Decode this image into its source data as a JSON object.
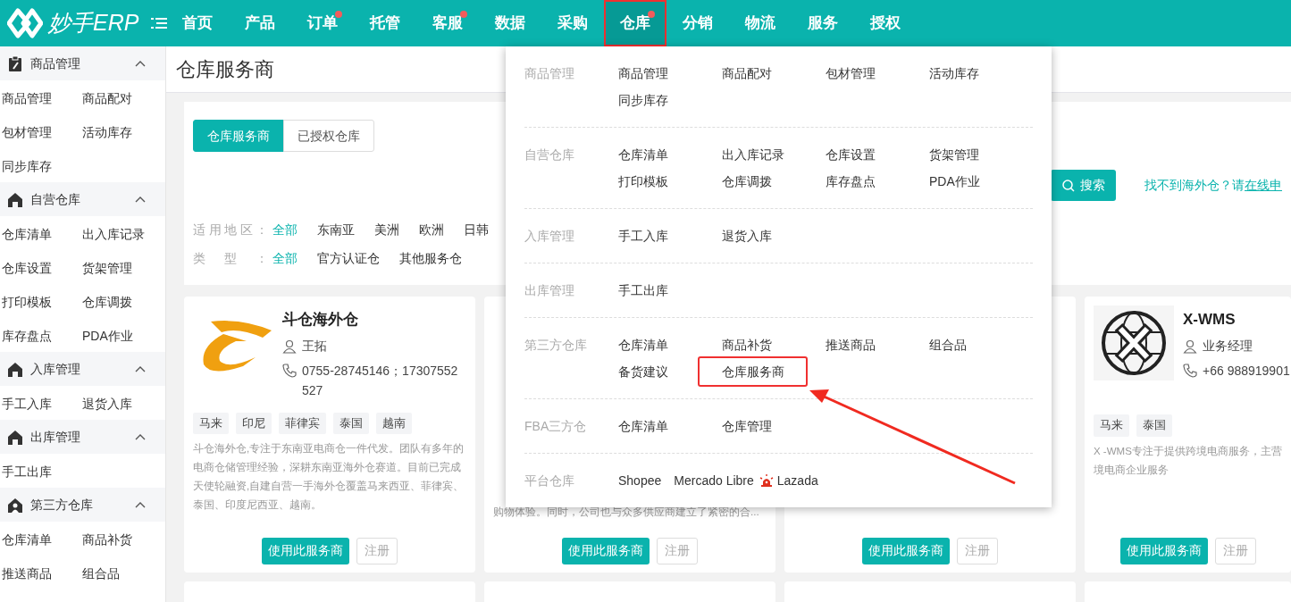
{
  "brand": {
    "name": "妙手ERP"
  },
  "nav": [
    {
      "label": "首页",
      "dot": false,
      "selected": false,
      "highlighted": false
    },
    {
      "label": "产品",
      "dot": false,
      "selected": false,
      "highlighted": false
    },
    {
      "label": "订单",
      "dot": true,
      "selected": false,
      "highlighted": false
    },
    {
      "label": "托管",
      "dot": false,
      "selected": false,
      "highlighted": false
    },
    {
      "label": "客服",
      "dot": true,
      "selected": false,
      "highlighted": false
    },
    {
      "label": "数据",
      "dot": false,
      "selected": false,
      "highlighted": false
    },
    {
      "label": "采购",
      "dot": false,
      "selected": false,
      "highlighted": false
    },
    {
      "label": "仓库",
      "dot": true,
      "selected": true,
      "highlighted": true
    },
    {
      "label": "分销",
      "dot": false,
      "selected": false,
      "highlighted": false
    },
    {
      "label": "物流",
      "dot": false,
      "selected": false,
      "highlighted": false
    },
    {
      "label": "服务",
      "dot": false,
      "selected": false,
      "highlighted": false
    },
    {
      "label": "授权",
      "dot": false,
      "selected": false,
      "highlighted": false
    }
  ],
  "sidebar": [
    {
      "title": "商品管理",
      "expanded": true,
      "items": [
        "商品管理",
        "商品配对",
        "包材管理",
        "活动库存",
        "同步库存"
      ]
    },
    {
      "title": "自营仓库",
      "expanded": true,
      "items": [
        "仓库清单",
        "出入库记录",
        "仓库设置",
        "货架管理",
        "打印模板",
        "仓库调拨",
        "库存盘点",
        "PDA作业"
      ]
    },
    {
      "title": "入库管理",
      "expanded": true,
      "items": [
        "手工入库",
        "退货入库"
      ]
    },
    {
      "title": "出库管理",
      "expanded": true,
      "items": [
        "手工出库"
      ]
    },
    {
      "title": "第三方仓库",
      "expanded": true,
      "items": [
        "仓库清单",
        "商品补货",
        "推送商品",
        "组合品"
      ]
    }
  ],
  "page_title": "仓库服务商",
  "tabs": [
    {
      "label": "仓库服务商",
      "selected": true
    },
    {
      "label": "已授权仓库",
      "selected": false
    }
  ],
  "search": {
    "label": "搜索"
  },
  "help": {
    "text": "找不到海外仓？请",
    "link": "在线申"
  },
  "filters": [
    {
      "label": "适用地区：",
      "options": [
        {
          "label": "全部",
          "selected": true
        },
        {
          "label": "东南亚",
          "selected": false
        },
        {
          "label": "美洲",
          "selected": false
        },
        {
          "label": "欧洲",
          "selected": false
        },
        {
          "label": "日韩",
          "selected": false
        }
      ]
    },
    {
      "label": "类型：",
      "options": [
        {
          "label": "全部",
          "selected": true
        },
        {
          "label": "官方认证仓",
          "selected": false
        },
        {
          "label": "其他服务仓",
          "selected": false
        }
      ]
    }
  ],
  "cards": [
    {
      "title": "斗仓海外仓",
      "contact": "王拓",
      "phone": "0755-28745146；17307552527",
      "tags": [
        "马来",
        "印尼",
        "菲律宾",
        "泰国",
        "越南"
      ],
      "description": [
        "斗仓海外仓,专注于东南亚电商仓一件代发。团队有多年的",
        "电商仓储管理经验，深耕东南亚海外仓赛道。目前已完成",
        "天使轮融资,自建自营一手海外仓覆盖马来西亚、菲律宾、",
        "泰国、印度尼西亚、越南。"
      ],
      "primary": "使用此服务商",
      "secondary": "注册"
    },
    {
      "description": [
        "购物体验。同时，公司也与众多供应商建立了紧密的合..."
      ],
      "primary": "使用此服务商",
      "secondary": "注册"
    },
    {
      "primary": "使用此服务商",
      "secondary": "注册"
    },
    {
      "title": "X-WMS",
      "contact": "业务经理",
      "phone": "+66 988919901",
      "tags": [
        "马来",
        "泰国"
      ],
      "description": [
        "X -WMS专注于提供跨境电商服务，主营",
        "境电商企业服务"
      ],
      "primary": "使用此服务商",
      "secondary": "注册"
    }
  ],
  "dropdown": {
    "sections": [
      {
        "label": "商品管理",
        "items": [
          {
            "label": "商品管理"
          },
          {
            "label": "商品配对"
          },
          {
            "label": "包材管理"
          },
          {
            "label": "活动库存"
          },
          {
            "label": "同步库存"
          }
        ]
      },
      {
        "label": "自营仓库",
        "items": [
          {
            "label": "仓库清单"
          },
          {
            "label": "出入库记录"
          },
          {
            "label": "仓库设置"
          },
          {
            "label": "货架管理"
          },
          {
            "label": "打印模板"
          },
          {
            "label": "仓库调拨"
          },
          {
            "label": "库存盘点"
          },
          {
            "label": "PDA作业"
          }
        ]
      },
      {
        "label": "入库管理",
        "items": [
          {
            "label": "手工入库"
          },
          {
            "label": "退货入库"
          }
        ]
      },
      {
        "label": "出库管理",
        "items": [
          {
            "label": "手工出库"
          }
        ]
      },
      {
        "label": "第三方仓库",
        "items": [
          {
            "label": "仓库清单",
            "highlighted": false
          },
          {
            "label": "商品补货",
            "highlighted": false
          },
          {
            "label": "推送商品",
            "highlighted": false
          },
          {
            "label": "组合品",
            "highlighted": false
          },
          {
            "label": "备货建议",
            "highlighted": false
          },
          {
            "label": "仓库服务商",
            "highlighted": true
          }
        ]
      },
      {
        "label": "FBA三方仓",
        "items": [
          {
            "label": "仓库清单"
          },
          {
            "label": "仓库管理"
          }
        ]
      },
      {
        "label": "平台仓库",
        "items": [
          {
            "label": "Shopee",
            "kind": "text"
          },
          {
            "label": "Mercado Libre",
            "kind": "text"
          },
          {
            "label": "Lazada",
            "kind": "icon"
          }
        ]
      }
    ]
  }
}
